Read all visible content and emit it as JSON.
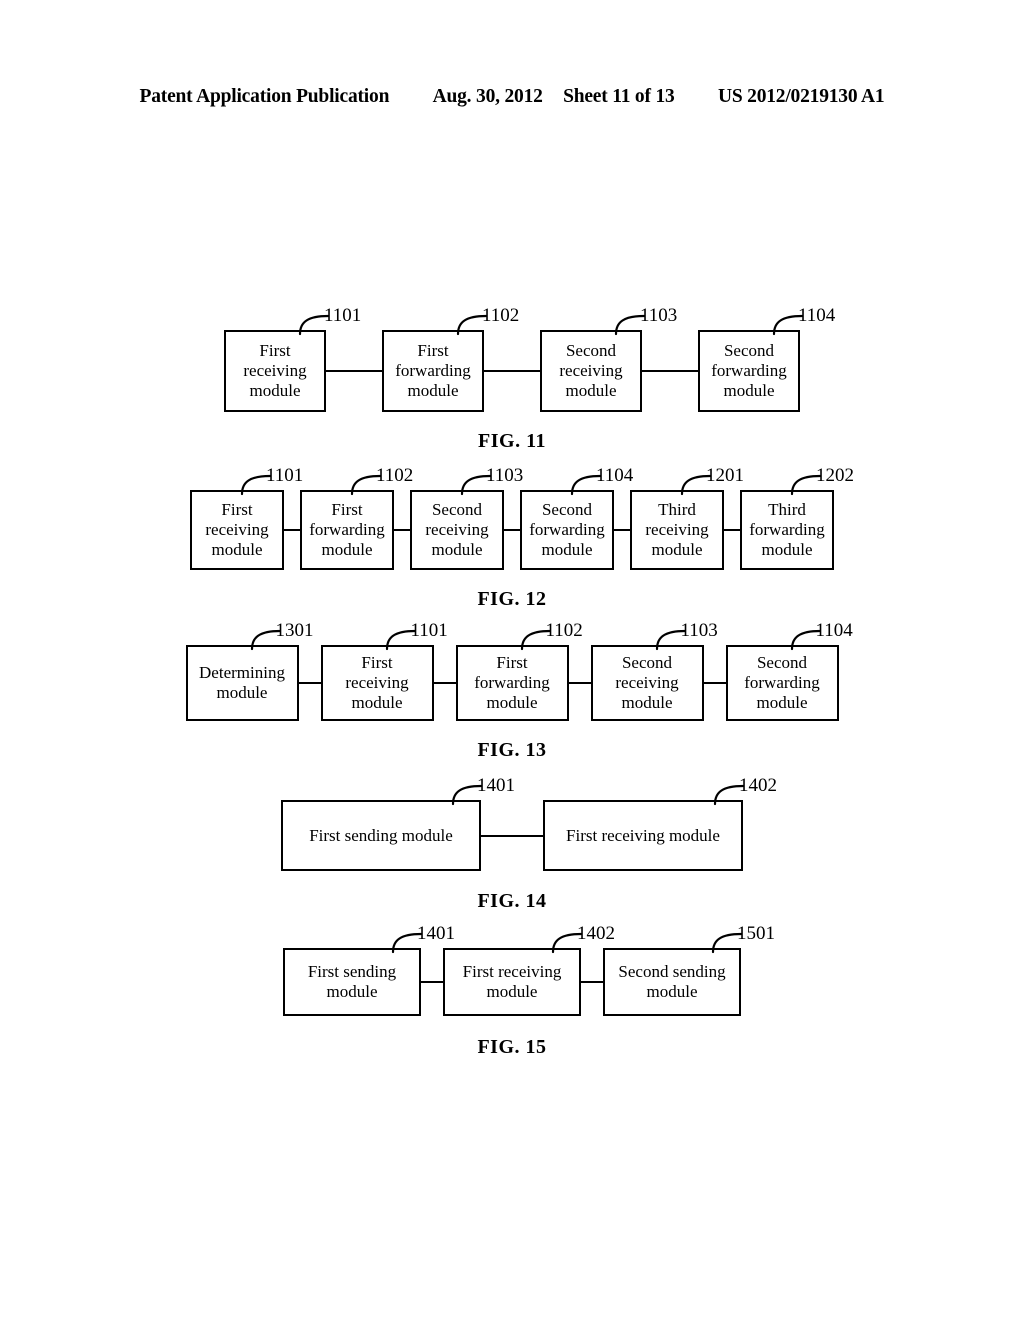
{
  "header": {
    "publication": "Patent Application Publication",
    "date": "Aug. 30, 2012",
    "sheet": "Sheet 11 of 13",
    "pub_number": "US 2012/0219130 A1"
  },
  "colors": {
    "ink": "#000000",
    "paper": "#ffffff"
  },
  "figures": [
    {
      "caption": "FIG. 11",
      "boxes": [
        {
          "label": "First\nreceiving\nmodule",
          "ref": "1101"
        },
        {
          "label": "First\nforwarding\nmodule",
          "ref": "1102"
        },
        {
          "label": "Second\nreceiving\nmodule",
          "ref": "1103"
        },
        {
          "label": "Second\nforwarding\nmodule",
          "ref": "1104"
        }
      ]
    },
    {
      "caption": "FIG. 12",
      "boxes": [
        {
          "label": "First\nreceiving\nmodule",
          "ref": "1101"
        },
        {
          "label": "First\nforwarding\nmodule",
          "ref": "1102"
        },
        {
          "label": "Second\nreceiving\nmodule",
          "ref": "1103"
        },
        {
          "label": "Second\nforwarding\nmodule",
          "ref": "1104"
        },
        {
          "label": "Third\nreceiving\nmodule",
          "ref": "1201"
        },
        {
          "label": "Third\nforwarding\nmodule",
          "ref": "1202"
        }
      ]
    },
    {
      "caption": "FIG. 13",
      "boxes": [
        {
          "label": "Determining\nmodule",
          "ref": "1301"
        },
        {
          "label": "First\nreceiving\nmodule",
          "ref": "1101"
        },
        {
          "label": "First\nforwarding\nmodule",
          "ref": "1102"
        },
        {
          "label": "Second\nreceiving\nmodule",
          "ref": "1103"
        },
        {
          "label": "Second\nforwarding\nmodule",
          "ref": "1104"
        }
      ]
    },
    {
      "caption": "FIG. 14",
      "boxes": [
        {
          "label": "First sending module",
          "ref": "1401"
        },
        {
          "label": "First receiving module",
          "ref": "1402"
        }
      ]
    },
    {
      "caption": "FIG. 15",
      "boxes": [
        {
          "label": "First sending\nmodule",
          "ref": "1401"
        },
        {
          "label": "First receiving\nmodule",
          "ref": "1402"
        },
        {
          "label": "Second sending\nmodule",
          "ref": "1501"
        }
      ]
    }
  ]
}
